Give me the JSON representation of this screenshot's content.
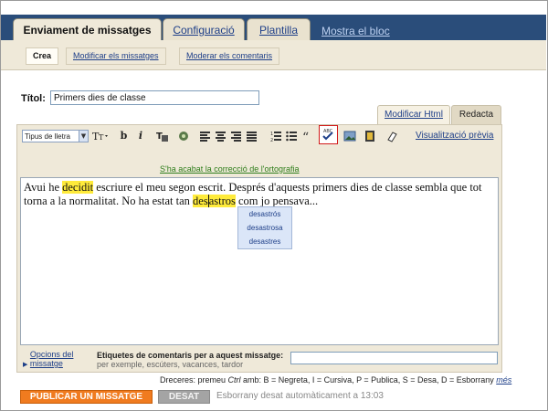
{
  "tabs": [
    {
      "label": "Enviament de missatges",
      "active": true
    },
    {
      "label": "Configuració",
      "active": false
    },
    {
      "label": "Plantilla",
      "active": false
    }
  ],
  "top_link": "Mostra el  bloc",
  "subtabs": [
    {
      "label": "Crea",
      "active": true
    },
    {
      "label": "Modificar els missatges",
      "active": false
    },
    {
      "label": "Moderar els comentaris",
      "active": false
    }
  ],
  "title": {
    "label": "Títol:",
    "value": "Primers dies de classe"
  },
  "mode_tabs": {
    "html": "Modificar Html",
    "compose": "Redacta"
  },
  "toolbar": {
    "font_select": "Tipus de lletra",
    "bold": "b",
    "italic": "i",
    "preview": "Visualització prèvia",
    "icons": [
      "font-size-icon",
      "bold-icon",
      "italic-icon",
      "text-color-icon",
      "link-icon",
      "align-left-icon",
      "align-center-icon",
      "align-right-icon",
      "align-justify-icon",
      "numbered-list-icon",
      "bullet-list-icon",
      "quote-icon",
      "spellcheck-icon",
      "image-icon",
      "video-icon",
      "remove-formatting-icon"
    ]
  },
  "spell_message": "S'ha acabat la correcció de l'ortografia",
  "body": {
    "p1": "Avui he ",
    "w1": "decidit",
    "p2": " escriure el meu segon escrit. Després d'aquests primers dies de classe sembla que tot torna a la normalitat. No ha estat tan ",
    "w2a": "des",
    "w2b": "astros",
    "p3": " com jo pensava..."
  },
  "suggestions": [
    "desastrós",
    "desastrosa",
    "desastres"
  ],
  "labels": {
    "options_link": "Opcions del missatge",
    "title": "Etiquetes de comentaris per a aquest missatge:",
    "hint": "per exemple, escúters, vacances, tardor",
    "value": ""
  },
  "shortcuts": {
    "prefix": "Dreceres: premeu ",
    "key": "Ctrl",
    "rest": " amb: B = Negreta, I = Cursiva, P = Publica, S = Desa, D = Esborrany ",
    "more": "més"
  },
  "actions": {
    "publish": "PUBLICAR UN MISSATGE",
    "save": "DESAT",
    "autosave": "Esborrany desat automàticament a 13:03"
  },
  "colors": {
    "header_bg": "#2a4d7a",
    "tab_bg": "#efe9d9",
    "link": "#1d3e88",
    "highlight": "#ffeb3b",
    "publish": "#f07b1f",
    "spell_ok": "#2e7d1a"
  }
}
